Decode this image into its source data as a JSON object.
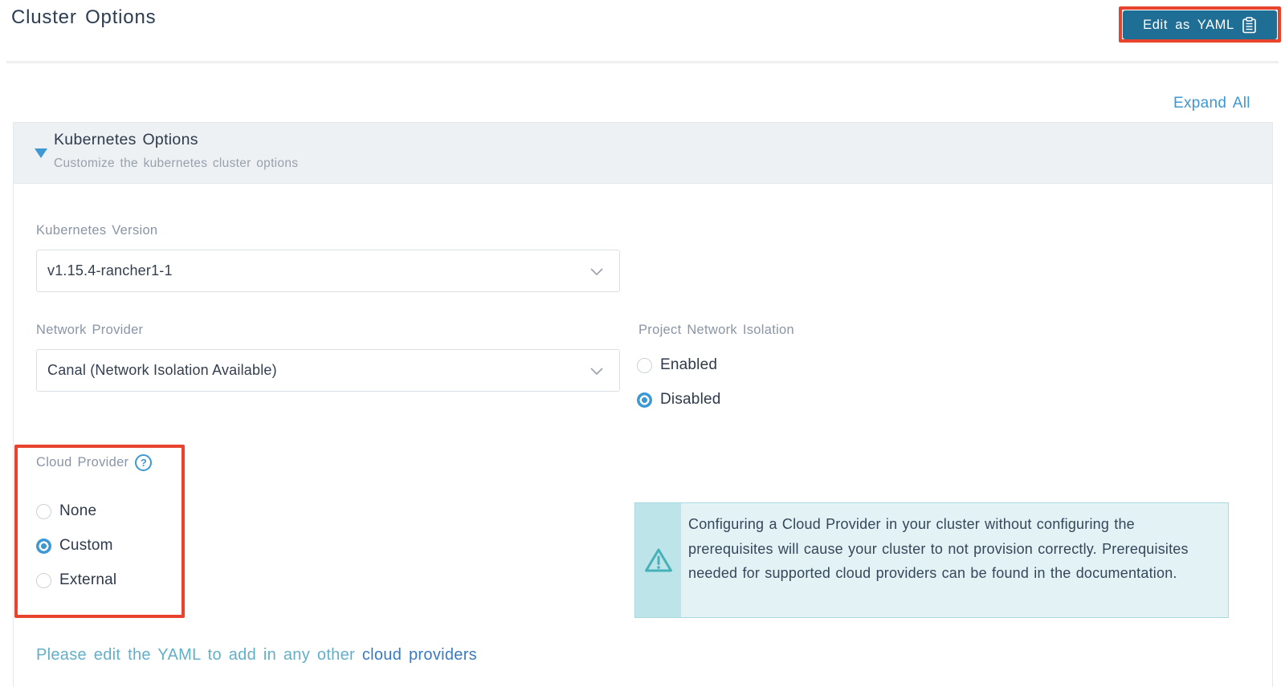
{
  "page": {
    "title": "Cluster Options"
  },
  "header": {
    "edit_yaml_button": "Edit as YAML",
    "expand_all": "Expand All"
  },
  "accordion": {
    "title": "Kubernetes Options",
    "subtitle": "Customize the kubernetes cluster options",
    "expanded": true
  },
  "form": {
    "kubernetes_version": {
      "label": "Kubernetes Version",
      "value": "v1.15.4-rancher1-1"
    },
    "network_provider": {
      "label": "Network Provider",
      "value": "Canal (Network Isolation Available)"
    },
    "project_network_isolation": {
      "label": "Project Network Isolation",
      "options": [
        {
          "label": "Enabled",
          "selected": false
        },
        {
          "label": "Disabled",
          "selected": true
        }
      ]
    },
    "cloud_provider": {
      "label": "Cloud Provider",
      "options": [
        {
          "label": "None",
          "selected": false
        },
        {
          "label": "Custom",
          "selected": true
        },
        {
          "label": "External",
          "selected": false
        }
      ]
    }
  },
  "warning": {
    "text": "Configuring a Cloud Provider in your cluster without configuring the prerequisites will cause your cluster to not provision correctly. Prerequisites needed for supported cloud providers can be found in the documentation."
  },
  "footer_note": {
    "text": "Please edit the YAML to add in any other ",
    "link": "cloud providers"
  },
  "icons": {
    "help_glyph": "?",
    "edit_yaml_icon": "clipboard-icon",
    "accordion_caret": "caret-down-icon",
    "select_chevron": "chevron-down-icon",
    "warning_icon": "warning-triangle-icon"
  },
  "colors": {
    "accent": "#3d98d3",
    "button-bg": "#1f6e96",
    "annotation-red": "#e8432d",
    "warning-bg": "#e3f2f5",
    "warning-strip": "#bde4e8",
    "warning-border": "#a7d9df",
    "warning-icon": "#47b1ba",
    "title-color": "#2c3d52",
    "label-gray": "#8a95a5",
    "text-dark": "#303d4f",
    "muted-teal": "#63afc8",
    "link-blue": "#3a7ac1",
    "header-bg": "#eef1f4",
    "border": "#e3e8eb"
  }
}
